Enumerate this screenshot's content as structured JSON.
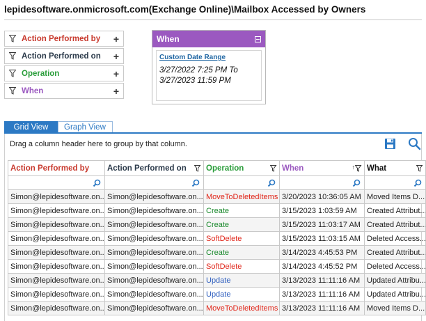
{
  "title": "lepidesoftware.onmicrosoft.com(Exchange Online)\\Mailbox Accessed by Owners",
  "colors": {
    "accent_blue": "#2c79c4",
    "when_purple": "#9b59c0",
    "red": "#c83a2e",
    "green": "#2a9d3a",
    "purple": "#9b59c0",
    "dark": "#333333"
  },
  "filters": [
    {
      "label": "Action Performed by",
      "color": "#c83a2e",
      "icon": "filter-icon"
    },
    {
      "label": "Action Performed on",
      "color": "#2b3a4a",
      "icon": "filter-icon"
    },
    {
      "label": "Operation",
      "color": "#2a9d3a",
      "icon": "filter-icon"
    },
    {
      "label": "When",
      "color": "#9b59c0",
      "icon": "filter-icon"
    }
  ],
  "when_panel": {
    "header": "When",
    "link": "Custom Date Range",
    "range_line1": "3/27/2022 7:25 PM To",
    "range_line2": "3/27/2023 11:59 PM"
  },
  "tabs": {
    "grid": "Grid View",
    "graph": "Graph View"
  },
  "group_by_hint": "Drag a column header here to group by that column.",
  "columns": [
    {
      "label": "Action Performed by",
      "color": "#c83a2e"
    },
    {
      "label": "Action Performed on",
      "color": "#2b3a4a"
    },
    {
      "label": "Operation",
      "color": "#2a9d3a"
    },
    {
      "label": "When",
      "color": "#9b59c0"
    },
    {
      "label": "What",
      "color": "#111111"
    }
  ],
  "rows": [
    {
      "by": "Simon@lepidesoftware.on...",
      "on": "Simon@lepidesoftware.on...",
      "op": "MoveToDeletedItems",
      "op_class": "op-red",
      "when": "3/20/2023 10:36:05 AM",
      "what": "Moved Items D..."
    },
    {
      "by": "Simon@lepidesoftware.on...",
      "on": "Simon@lepidesoftware.on...",
      "op": "Create",
      "op_class": "op-green",
      "when": "3/15/2023 1:03:59 AM",
      "what": "Created Attribut..."
    },
    {
      "by": "Simon@lepidesoftware.on...",
      "on": "Simon@lepidesoftware.on...",
      "op": "Create",
      "op_class": "op-green",
      "when": "3/15/2023 11:03:17 AM",
      "what": "Created Attribut..."
    },
    {
      "by": "Simon@lepidesoftware.on...",
      "on": "Simon@lepidesoftware.on...",
      "op": "SoftDelete",
      "op_class": "op-red",
      "when": "3/15/2023 11:03:15 AM",
      "what": "Deleted Access..."
    },
    {
      "by": "Simon@lepidesoftware.on...",
      "on": "Simon@lepidesoftware.on...",
      "op": "Create",
      "op_class": "op-green",
      "when": "3/14/2023 4:45:53 PM",
      "what": "Created Attribut..."
    },
    {
      "by": "Simon@lepidesoftware.on...",
      "on": "Simon@lepidesoftware.on...",
      "op": "SoftDelete",
      "op_class": "op-red",
      "when": "3/14/2023 4:45:52 PM",
      "what": "Deleted Access..."
    },
    {
      "by": "Simon@lepidesoftware.on...",
      "on": "Simon@lepidesoftware.on...",
      "op": "Update",
      "op_class": "op-blue",
      "when": "3/13/2023 11:11:16 AM",
      "what": "Updated Attribu..."
    },
    {
      "by": "Simon@lepidesoftware.on...",
      "on": "Simon@lepidesoftware.on...",
      "op": "Update",
      "op_class": "op-blue",
      "when": "3/13/2023 11:11:16 AM",
      "what": "Updated Attribu..."
    },
    {
      "by": "Simon@lepidesoftware.on...",
      "on": "Simon@lepidesoftware.on...",
      "op": "MoveToDeletedItems",
      "op_class": "op-red",
      "when": "3/13/2023 11:11:16 AM",
      "what": "Moved Items D..."
    }
  ]
}
